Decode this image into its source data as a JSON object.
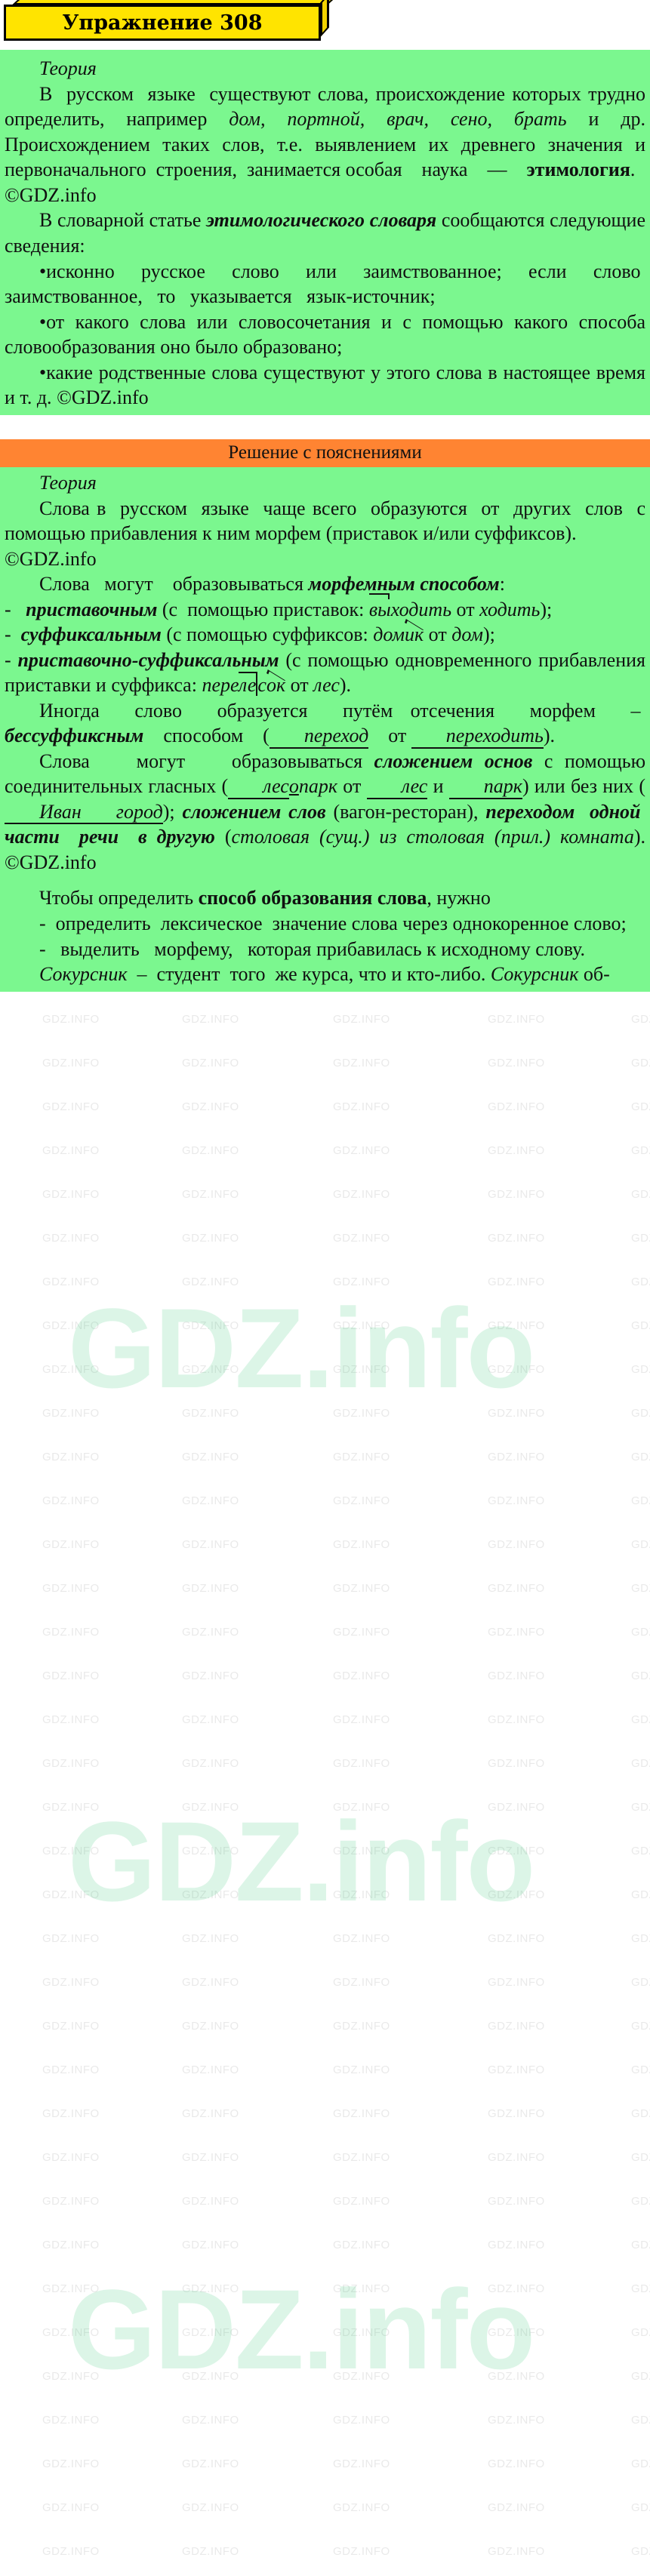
{
  "title": {
    "label": "Упражнение 308"
  },
  "watermark": {
    "small": "GDZ.INFO",
    "big": "GDZ.info"
  },
  "section_theory_task": {
    "heading": "Теория",
    "paragraphs": [
      {
        "id": "p1",
        "text": "В русском языке существуют слова, происхождение которых трудно определить, например дом, портной, врач, сено, брать и др. Происхождением таких слов, т.е. выявлением их древнего значения и первоначального строения, занимается особая наука — этимология. ©GDZ.info",
        "italic_words": "дом, портной, врач, сено, брать",
        "bold_word": "этимология",
        "credit": "©GDZ.info"
      },
      {
        "id": "p2",
        "text": "В словарной статье этимологического словаря сообщаются следующие сведения:",
        "bold_italic": "этимологического словаря"
      },
      {
        "id": "b1",
        "text": "•исконно русское слово или заимствованное; если слово заимствованное, то указывается язык-источник;"
      },
      {
        "id": "b2",
        "text": "•от какого слова или словосочетания и с помощью какого способа словообразования оно было образовано;"
      },
      {
        "id": "b3",
        "text": "•какие родственные слова существуют у этого слова в настоящее время и т. д. ©GDZ.info",
        "credit": "©GDZ.info"
      }
    ]
  },
  "solution_bar": {
    "label": "Решение с пояснениями"
  },
  "section_solution": {
    "heading": "Теория",
    "paragraphs": [
      {
        "id": "s1",
        "text": "Слова в русском языке чаще всего образуются от других слов с помощью прибавления к ним морфем (приставок и/или суффиксов). ©GDZ.info",
        "credit": "©GDZ.info"
      },
      {
        "id": "s2",
        "lead": "Слова могут образовываться ",
        "bold_italic": "морфемным способом",
        "tail": ":"
      },
      {
        "id": "s3",
        "marker": "-",
        "bold_italic": "приставочным",
        "text": " (с помощью приставок: выходить от ходить);",
        "example_word": "выходить",
        "example_source": "ходить"
      },
      {
        "id": "s4",
        "marker": "-",
        "bold_italic": "суффиксальным",
        "text": " (с помощью суффиксов: домик от дом);",
        "example_word": "домик",
        "example_source": "дом"
      },
      {
        "id": "s5",
        "marker": "-",
        "bold_italic": "приставочно-суффиксальным",
        "text": " (с помощью одновременного прибавления приставки и суффикса: перелесок от лес).",
        "example_word": "перелесок",
        "example_source": "лес"
      },
      {
        "id": "s6",
        "lead": "Иногда слово образуется путём отсечения морфем – ",
        "bold_italic": "бессуффиксным",
        "tail": " способом (переход от переходить).",
        "example_word": "переход",
        "example_source": "переходить"
      },
      {
        "id": "s7",
        "lead": "Слова могут образовываться ",
        "bold_italic_1": "сложением основ",
        "mid_1": " с помощью соединительных гласных (лесопарк от лес и парк) или без них (Ивангород); ",
        "bold_italic_2": "сложением слов",
        "mid_2": " (вагон-ресторан), ",
        "bold_italic_3": "переходом одной части речи в другую",
        "mid_3": " (столовая (сущ.) из столовая (прил.) комната). ©GDZ.info",
        "examples": [
          "лесопарк",
          "лес",
          "парк",
          "Ивангород",
          "вагон-ресторан",
          "столовая",
          "комната"
        ],
        "credit": "©GDZ.info"
      },
      {
        "id": "s8",
        "lead": "Чтобы определить ",
        "bold": "способ образования слова",
        "tail": ", нужно"
      },
      {
        "id": "s9",
        "text": "- определить лексическое значение слова через однокоренное слово;"
      },
      {
        "id": "s10",
        "text": "- выделить морфему, которая прибавилась к исходному слову."
      },
      {
        "id": "s11",
        "italic_1": "Сокурсник",
        "mid": " – студент того же курса, что и кто-либо. ",
        "italic_2": "Сокурсник",
        "tail": " об-"
      }
    ]
  },
  "colors": {
    "green_bg": "#7bf78f",
    "orange_bar": "#ff8432",
    "plaque_yellow": "#ffe400",
    "text": "#101010"
  }
}
